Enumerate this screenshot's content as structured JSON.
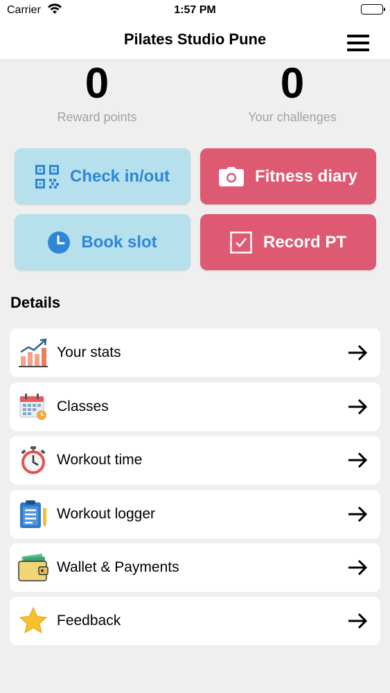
{
  "status_bar": {
    "carrier": "Carrier",
    "time": "1:57 PM"
  },
  "nav": {
    "title": "Pilates Studio Pune"
  },
  "stats": {
    "reward_points": {
      "value": "0",
      "label": "Reward points"
    },
    "challenges": {
      "value": "0",
      "label": "Your challenges"
    }
  },
  "actions": {
    "check_in": {
      "label": "Check in/out",
      "icon": "qr-code-icon"
    },
    "fitness_diary": {
      "label": "Fitness diary",
      "icon": "camera-icon"
    },
    "book_slot": {
      "label": "Book slot",
      "icon": "clock-icon"
    },
    "record_pt": {
      "label": "Record PT",
      "icon": "checkbox-icon"
    }
  },
  "details": {
    "title": "Details",
    "items": [
      {
        "label": "Your stats",
        "icon": "chart-icon"
      },
      {
        "label": "Classes",
        "icon": "calendar-icon"
      },
      {
        "label": "Workout time",
        "icon": "stopwatch-icon"
      },
      {
        "label": "Workout logger",
        "icon": "clipboard-icon"
      },
      {
        "label": "Wallet & Payments",
        "icon": "wallet-icon"
      },
      {
        "label": "Feedback",
        "icon": "star-icon"
      }
    ]
  },
  "colors": {
    "blue_tile": "#b5e0ec",
    "blue_text": "#2f86d6",
    "red_tile": "#de5a72",
    "background": "#efefef"
  }
}
